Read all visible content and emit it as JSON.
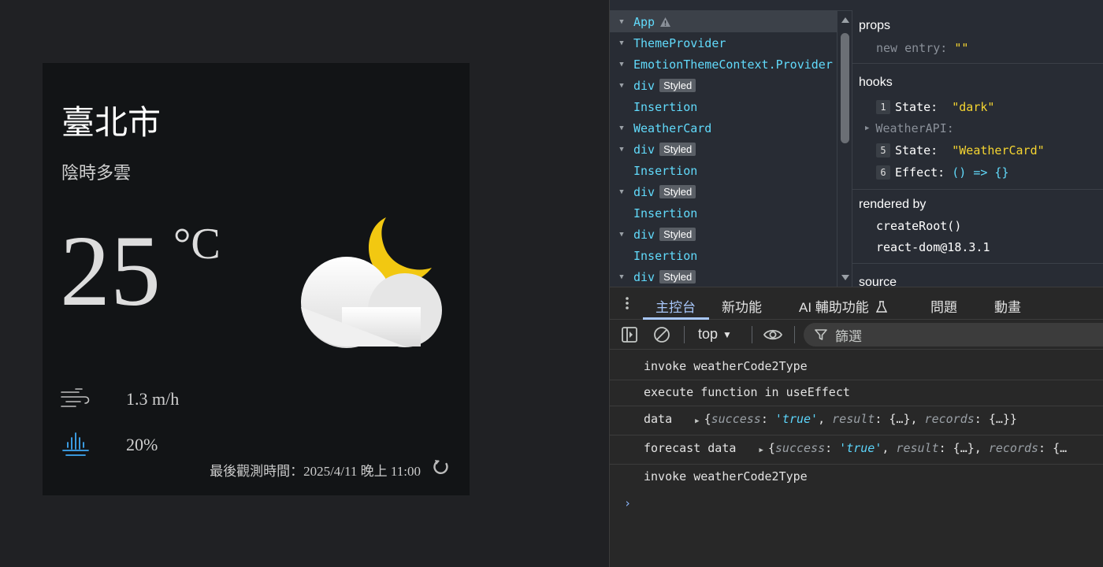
{
  "weather": {
    "location": "臺北市",
    "description": "陰時多雲",
    "temperature": "25",
    "unit": "°C",
    "wind_speed": "1.3 m/h",
    "rain_probability": "20%",
    "observation": "最後觀測時間：2025/4/11 晚上 11:00",
    "illustration": "cloudy-night-icon",
    "icons": [
      "airflow-icon",
      "rain-icon",
      "refresh-icon"
    ],
    "colors": {
      "card": "#121416",
      "moon": "#f2c811",
      "text": "#dddddd"
    }
  },
  "components": {
    "tree": [
      {
        "name": "App",
        "badge": "",
        "warning": true,
        "caret": true,
        "selected": true
      },
      {
        "name": "ThemeProvider",
        "badge": "",
        "caret": true
      },
      {
        "name": "EmotionThemeContext.Provider",
        "badge": "",
        "caret": true
      },
      {
        "name": "div",
        "badge": "Styled",
        "caret": true
      },
      {
        "name": "Insertion",
        "badge": "",
        "caret": false
      },
      {
        "name": "WeatherCard",
        "badge": "",
        "caret": true
      },
      {
        "name": "div",
        "badge": "Styled",
        "caret": true
      },
      {
        "name": "Insertion",
        "badge": "",
        "caret": false
      },
      {
        "name": "div",
        "badge": "Styled",
        "caret": true
      },
      {
        "name": "Insertion",
        "badge": "",
        "caret": false
      },
      {
        "name": "div",
        "badge": "Styled",
        "caret": true
      },
      {
        "name": "Insertion",
        "badge": "",
        "caret": false
      },
      {
        "name": "div",
        "badge": "Styled",
        "caret": true
      }
    ],
    "inspector": {
      "props_heading": "props",
      "props_new_entry_label": "new entry:",
      "props_new_entry_value": "\"\"",
      "hooks_heading": "hooks",
      "hooks": [
        {
          "index": "1",
          "label": "State:",
          "value": "\"dark\""
        },
        {
          "index": "",
          "label": "WeatherAPI:",
          "value": ""
        },
        {
          "index": "5",
          "label": "State:",
          "value": "\"WeatherCard\""
        },
        {
          "index": "6",
          "label": "Effect:",
          "value": "() => {}"
        }
      ],
      "rendered_by_heading": "rendered by",
      "rendered_by": [
        "createRoot()",
        "react-dom@18.3.1"
      ],
      "source_heading": "source"
    }
  },
  "drawer": {
    "tabs": [
      "主控台",
      "新功能",
      "AI 輔助功能",
      "問題",
      "動畫"
    ],
    "active_tab": "主控台"
  },
  "console": {
    "context": "top",
    "filter_placeholder": "篩選",
    "messages": [
      "invoke weatherCode2Type",
      "execute function in useEffect",
      "data",
      "forecast data",
      "invoke weatherCode2Type"
    ],
    "data_object": {
      "open": "{",
      "success_key": "success",
      "success_value": "'true'",
      "result_key": "result",
      "result_value": "{…}",
      "records_key": "records",
      "records_value": "{…}}",
      "records_value_truncated": "{…"
    },
    "prompt": "›"
  }
}
